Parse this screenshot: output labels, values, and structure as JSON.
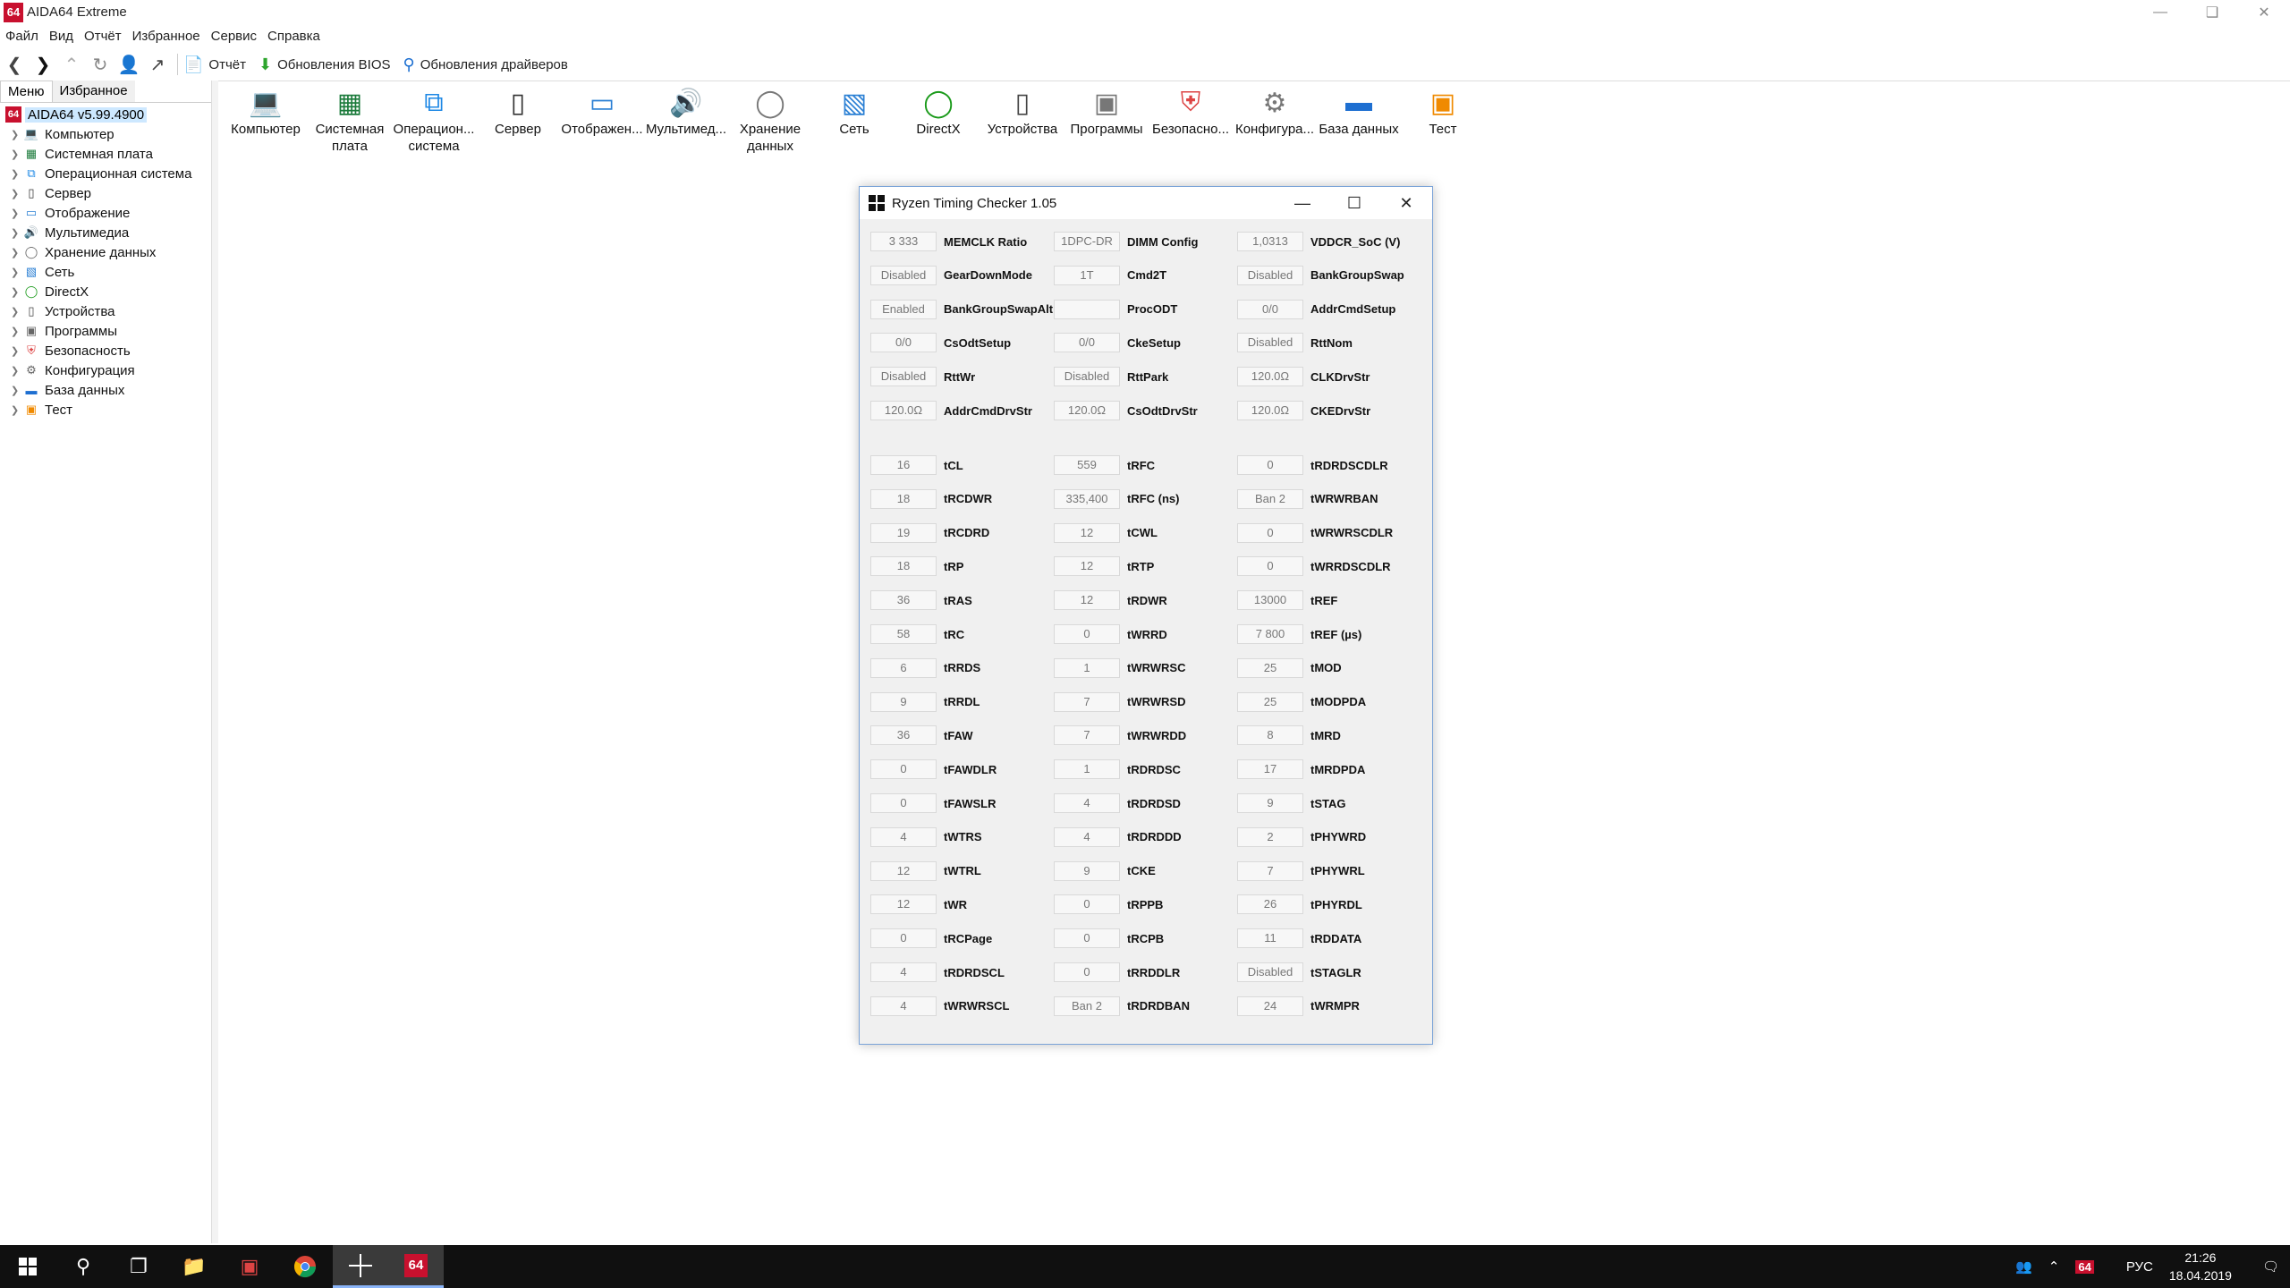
{
  "window": {
    "title": "AIDA64 Extreme",
    "logo": "64"
  },
  "menu": [
    "Файл",
    "Вид",
    "Отчёт",
    "Избранное",
    "Сервис",
    "Справка"
  ],
  "toolbar": {
    "report": "Отчёт",
    "bios_updates": "Обновления BIOS",
    "driver_updates": "Обновления драйверов"
  },
  "leftpanel": {
    "tab_menu": "Меню",
    "tab_favorites": "Избранное",
    "root": "AIDA64 v5.99.4900",
    "items": [
      "Компьютер",
      "Системная плата",
      "Операционная система",
      "Сервер",
      "Отображение",
      "Мультимедиа",
      "Хранение данных",
      "Сеть",
      "DirectX",
      "Устройства",
      "Программы",
      "Безопасность",
      "Конфигурация",
      "База данных",
      "Тест"
    ]
  },
  "categories": [
    {
      "l1": "Компьютер",
      "l2": ""
    },
    {
      "l1": "Системная",
      "l2": "плата"
    },
    {
      "l1": "Операцион...",
      "l2": "система"
    },
    {
      "l1": "Сервер",
      "l2": ""
    },
    {
      "l1": "Отображен...",
      "l2": ""
    },
    {
      "l1": "Мультимед...",
      "l2": ""
    },
    {
      "l1": "Хранение",
      "l2": "данных"
    },
    {
      "l1": "Сеть",
      "l2": ""
    },
    {
      "l1": "DirectX",
      "l2": ""
    },
    {
      "l1": "Устройства",
      "l2": ""
    },
    {
      "l1": "Программы",
      "l2": ""
    },
    {
      "l1": "Безопасно...",
      "l2": ""
    },
    {
      "l1": "Конфигура...",
      "l2": ""
    },
    {
      "l1": "База данных",
      "l2": ""
    },
    {
      "l1": "Тест",
      "l2": ""
    }
  ],
  "dialog": {
    "title": "Ryzen Timing Checker 1.05",
    "top_rows": [
      [
        [
          "3 333",
          "MEMCLK Ratio"
        ],
        [
          "1DPC-DR",
          "DIMM Config"
        ],
        [
          "1,0313",
          "VDDCR_SoC (V)"
        ]
      ],
      [
        [
          "Disabled",
          "GearDownMode"
        ],
        [
          "1T",
          "Cmd2T"
        ],
        [
          "Disabled",
          "BankGroupSwap"
        ]
      ],
      [
        [
          "Enabled",
          "BankGroupSwapAlt"
        ],
        [
          "",
          "ProcODT"
        ],
        [
          "0/0",
          "AddrCmdSetup"
        ]
      ],
      [
        [
          "0/0",
          "CsOdtSetup"
        ],
        [
          "0/0",
          "CkeSetup"
        ],
        [
          "Disabled",
          "RttNom"
        ]
      ],
      [
        [
          "Disabled",
          "RttWr"
        ],
        [
          "Disabled",
          "RttPark"
        ],
        [
          "120.0Ω",
          "CLKDrvStr"
        ]
      ],
      [
        [
          "120.0Ω",
          "AddrCmdDrvStr"
        ],
        [
          "120.0Ω",
          "CsOdtDrvStr"
        ],
        [
          "120.0Ω",
          "CKEDrvStr"
        ]
      ]
    ],
    "timing_rows": [
      [
        [
          "16",
          "tCL"
        ],
        [
          "559",
          "tRFC"
        ],
        [
          "0",
          "tRDRDSCDLR"
        ]
      ],
      [
        [
          "18",
          "tRCDWR"
        ],
        [
          "335,400",
          "tRFC (ns)"
        ],
        [
          "Ban 2",
          "tWRWRBAN"
        ]
      ],
      [
        [
          "19",
          "tRCDRD"
        ],
        [
          "12",
          "tCWL"
        ],
        [
          "0",
          "tWRWRSCDLR"
        ]
      ],
      [
        [
          "18",
          "tRP"
        ],
        [
          "12",
          "tRTP"
        ],
        [
          "0",
          "tWRRDSCDLR"
        ]
      ],
      [
        [
          "36",
          "tRAS"
        ],
        [
          "12",
          "tRDWR"
        ],
        [
          "13000",
          "tREF"
        ]
      ],
      [
        [
          "58",
          "tRC"
        ],
        [
          "0",
          "tWRRD"
        ],
        [
          "7 800",
          "tREF (µs)"
        ]
      ],
      [
        [
          "6",
          "tRRDS"
        ],
        [
          "1",
          "tWRWRSC"
        ],
        [
          "25",
          "tMOD"
        ]
      ],
      [
        [
          "9",
          "tRRDL"
        ],
        [
          "7",
          "tWRWRSD"
        ],
        [
          "25",
          "tMODPDA"
        ]
      ],
      [
        [
          "36",
          "tFAW"
        ],
        [
          "7",
          "tWRWRDD"
        ],
        [
          "8",
          "tMRD"
        ]
      ],
      [
        [
          "0",
          "tFAWDLR"
        ],
        [
          "1",
          "tRDRDSC"
        ],
        [
          "17",
          "tMRDPDA"
        ]
      ],
      [
        [
          "0",
          "tFAWSLR"
        ],
        [
          "4",
          "tRDRDSD"
        ],
        [
          "9",
          "tSTAG"
        ]
      ],
      [
        [
          "4",
          "tWTRS"
        ],
        [
          "4",
          "tRDRDDD"
        ],
        [
          "2",
          "tPHYWRD"
        ]
      ],
      [
        [
          "12",
          "tWTRL"
        ],
        [
          "9",
          "tCKE"
        ],
        [
          "7",
          "tPHYWRL"
        ]
      ],
      [
        [
          "12",
          "tWR"
        ],
        [
          "0",
          "tRPPB"
        ],
        [
          "26",
          "tPHYRDL"
        ]
      ],
      [
        [
          "0",
          "tRCPage"
        ],
        [
          "0",
          "tRCPB"
        ],
        [
          "11",
          "tRDDATA"
        ]
      ],
      [
        [
          "4",
          "tRDRDSCL"
        ],
        [
          "0",
          "tRRDDLR"
        ],
        [
          "Disabled",
          "tSTAGLR"
        ]
      ],
      [
        [
          "4",
          "tWRWRSCL"
        ],
        [
          "Ban 2",
          "tRDRDBAN"
        ],
        [
          "24",
          "tWRMPR"
        ]
      ]
    ]
  },
  "taskbar": {
    "lang": "РУС",
    "time": "21:26",
    "date": "18.04.2019",
    "aida_badge": "64"
  }
}
